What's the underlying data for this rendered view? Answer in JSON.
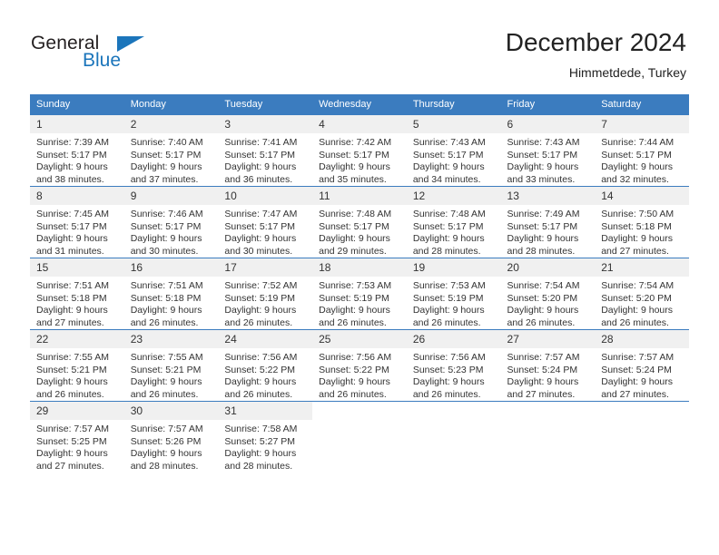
{
  "logo": {
    "word1": "General",
    "word2": "Blue",
    "triangle_color": "#1b75bb",
    "text_color": "#231f20"
  },
  "header": {
    "title": "December 2024",
    "subtitle": "Himmetdede, Turkey"
  },
  "theme": {
    "header_blue": "#3b7cbf",
    "daynum_band": "#f0f0f0",
    "text": "#333333"
  },
  "calendar": {
    "weekday_headers": [
      "Sunday",
      "Monday",
      "Tuesday",
      "Wednesday",
      "Thursday",
      "Friday",
      "Saturday"
    ],
    "weeks": [
      [
        {
          "day": "1",
          "sunrise": "Sunrise: 7:39 AM",
          "sunset": "Sunset: 5:17 PM",
          "daylight1": "Daylight: 9 hours",
          "daylight2": "and 38 minutes."
        },
        {
          "day": "2",
          "sunrise": "Sunrise: 7:40 AM",
          "sunset": "Sunset: 5:17 PM",
          "daylight1": "Daylight: 9 hours",
          "daylight2": "and 37 minutes."
        },
        {
          "day": "3",
          "sunrise": "Sunrise: 7:41 AM",
          "sunset": "Sunset: 5:17 PM",
          "daylight1": "Daylight: 9 hours",
          "daylight2": "and 36 minutes."
        },
        {
          "day": "4",
          "sunrise": "Sunrise: 7:42 AM",
          "sunset": "Sunset: 5:17 PM",
          "daylight1": "Daylight: 9 hours",
          "daylight2": "and 35 minutes."
        },
        {
          "day": "5",
          "sunrise": "Sunrise: 7:43 AM",
          "sunset": "Sunset: 5:17 PM",
          "daylight1": "Daylight: 9 hours",
          "daylight2": "and 34 minutes."
        },
        {
          "day": "6",
          "sunrise": "Sunrise: 7:43 AM",
          "sunset": "Sunset: 5:17 PM",
          "daylight1": "Daylight: 9 hours",
          "daylight2": "and 33 minutes."
        },
        {
          "day": "7",
          "sunrise": "Sunrise: 7:44 AM",
          "sunset": "Sunset: 5:17 PM",
          "daylight1": "Daylight: 9 hours",
          "daylight2": "and 32 minutes."
        }
      ],
      [
        {
          "day": "8",
          "sunrise": "Sunrise: 7:45 AM",
          "sunset": "Sunset: 5:17 PM",
          "daylight1": "Daylight: 9 hours",
          "daylight2": "and 31 minutes."
        },
        {
          "day": "9",
          "sunrise": "Sunrise: 7:46 AM",
          "sunset": "Sunset: 5:17 PM",
          "daylight1": "Daylight: 9 hours",
          "daylight2": "and 30 minutes."
        },
        {
          "day": "10",
          "sunrise": "Sunrise: 7:47 AM",
          "sunset": "Sunset: 5:17 PM",
          "daylight1": "Daylight: 9 hours",
          "daylight2": "and 30 minutes."
        },
        {
          "day": "11",
          "sunrise": "Sunrise: 7:48 AM",
          "sunset": "Sunset: 5:17 PM",
          "daylight1": "Daylight: 9 hours",
          "daylight2": "and 29 minutes."
        },
        {
          "day": "12",
          "sunrise": "Sunrise: 7:48 AM",
          "sunset": "Sunset: 5:17 PM",
          "daylight1": "Daylight: 9 hours",
          "daylight2": "and 28 minutes."
        },
        {
          "day": "13",
          "sunrise": "Sunrise: 7:49 AM",
          "sunset": "Sunset: 5:17 PM",
          "daylight1": "Daylight: 9 hours",
          "daylight2": "and 28 minutes."
        },
        {
          "day": "14",
          "sunrise": "Sunrise: 7:50 AM",
          "sunset": "Sunset: 5:18 PM",
          "daylight1": "Daylight: 9 hours",
          "daylight2": "and 27 minutes."
        }
      ],
      [
        {
          "day": "15",
          "sunrise": "Sunrise: 7:51 AM",
          "sunset": "Sunset: 5:18 PM",
          "daylight1": "Daylight: 9 hours",
          "daylight2": "and 27 minutes."
        },
        {
          "day": "16",
          "sunrise": "Sunrise: 7:51 AM",
          "sunset": "Sunset: 5:18 PM",
          "daylight1": "Daylight: 9 hours",
          "daylight2": "and 26 minutes."
        },
        {
          "day": "17",
          "sunrise": "Sunrise: 7:52 AM",
          "sunset": "Sunset: 5:19 PM",
          "daylight1": "Daylight: 9 hours",
          "daylight2": "and 26 minutes."
        },
        {
          "day": "18",
          "sunrise": "Sunrise: 7:53 AM",
          "sunset": "Sunset: 5:19 PM",
          "daylight1": "Daylight: 9 hours",
          "daylight2": "and 26 minutes."
        },
        {
          "day": "19",
          "sunrise": "Sunrise: 7:53 AM",
          "sunset": "Sunset: 5:19 PM",
          "daylight1": "Daylight: 9 hours",
          "daylight2": "and 26 minutes."
        },
        {
          "day": "20",
          "sunrise": "Sunrise: 7:54 AM",
          "sunset": "Sunset: 5:20 PM",
          "daylight1": "Daylight: 9 hours",
          "daylight2": "and 26 minutes."
        },
        {
          "day": "21",
          "sunrise": "Sunrise: 7:54 AM",
          "sunset": "Sunset: 5:20 PM",
          "daylight1": "Daylight: 9 hours",
          "daylight2": "and 26 minutes."
        }
      ],
      [
        {
          "day": "22",
          "sunrise": "Sunrise: 7:55 AM",
          "sunset": "Sunset: 5:21 PM",
          "daylight1": "Daylight: 9 hours",
          "daylight2": "and 26 minutes."
        },
        {
          "day": "23",
          "sunrise": "Sunrise: 7:55 AM",
          "sunset": "Sunset: 5:21 PM",
          "daylight1": "Daylight: 9 hours",
          "daylight2": "and 26 minutes."
        },
        {
          "day": "24",
          "sunrise": "Sunrise: 7:56 AM",
          "sunset": "Sunset: 5:22 PM",
          "daylight1": "Daylight: 9 hours",
          "daylight2": "and 26 minutes."
        },
        {
          "day": "25",
          "sunrise": "Sunrise: 7:56 AM",
          "sunset": "Sunset: 5:22 PM",
          "daylight1": "Daylight: 9 hours",
          "daylight2": "and 26 minutes."
        },
        {
          "day": "26",
          "sunrise": "Sunrise: 7:56 AM",
          "sunset": "Sunset: 5:23 PM",
          "daylight1": "Daylight: 9 hours",
          "daylight2": "and 26 minutes."
        },
        {
          "day": "27",
          "sunrise": "Sunrise: 7:57 AM",
          "sunset": "Sunset: 5:24 PM",
          "daylight1": "Daylight: 9 hours",
          "daylight2": "and 27 minutes."
        },
        {
          "day": "28",
          "sunrise": "Sunrise: 7:57 AM",
          "sunset": "Sunset: 5:24 PM",
          "daylight1": "Daylight: 9 hours",
          "daylight2": "and 27 minutes."
        }
      ],
      [
        {
          "day": "29",
          "sunrise": "Sunrise: 7:57 AM",
          "sunset": "Sunset: 5:25 PM",
          "daylight1": "Daylight: 9 hours",
          "daylight2": "and 27 minutes."
        },
        {
          "day": "30",
          "sunrise": "Sunrise: 7:57 AM",
          "sunset": "Sunset: 5:26 PM",
          "daylight1": "Daylight: 9 hours",
          "daylight2": "and 28 minutes."
        },
        {
          "day": "31",
          "sunrise": "Sunrise: 7:58 AM",
          "sunset": "Sunset: 5:27 PM",
          "daylight1": "Daylight: 9 hours",
          "daylight2": "and 28 minutes."
        },
        {
          "day": "",
          "sunrise": "",
          "sunset": "",
          "daylight1": "",
          "daylight2": ""
        },
        {
          "day": "",
          "sunrise": "",
          "sunset": "",
          "daylight1": "",
          "daylight2": ""
        },
        {
          "day": "",
          "sunrise": "",
          "sunset": "",
          "daylight1": "",
          "daylight2": ""
        },
        {
          "day": "",
          "sunrise": "",
          "sunset": "",
          "daylight1": "",
          "daylight2": ""
        }
      ]
    ]
  }
}
